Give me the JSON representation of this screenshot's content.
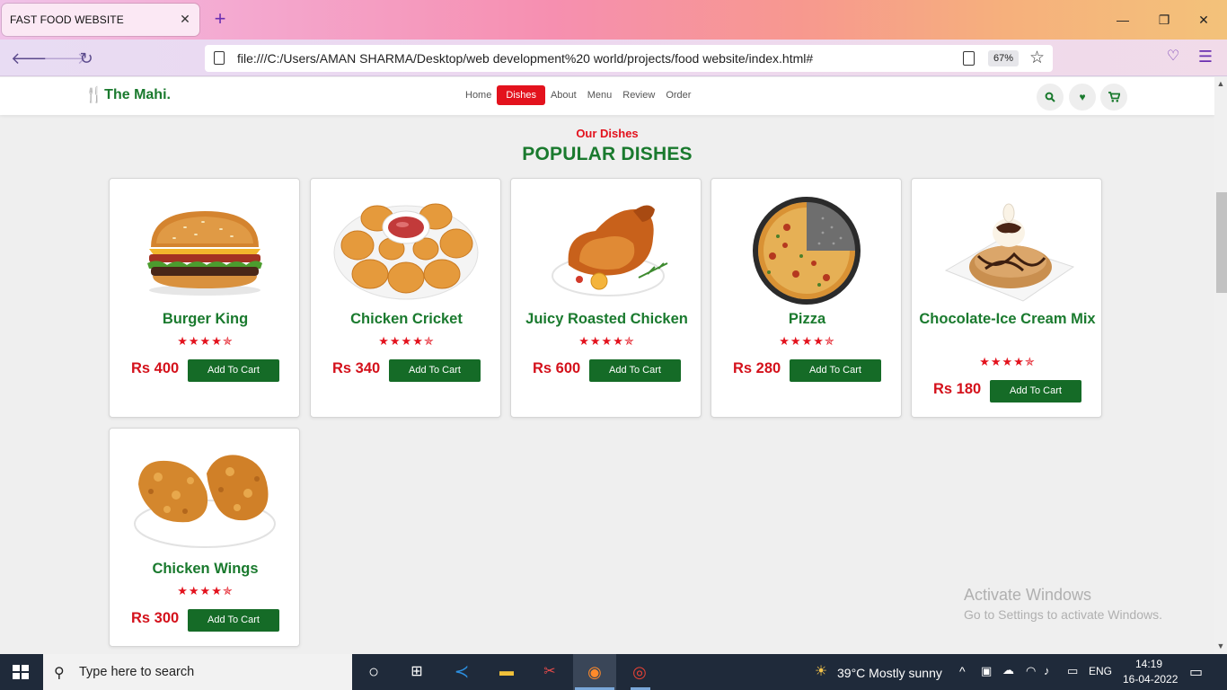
{
  "browser": {
    "tab_title": "FAST FOOD WEBSITE",
    "tab_close": "✕",
    "new_tab": "+",
    "url": "file:///C:/Users/AMAN SHARMA/Desktop/web development%20 world/projects/food website/index.html#",
    "zoom": "67%",
    "window_controls": [
      "—",
      "❐",
      "✕"
    ]
  },
  "site": {
    "logo": "The Mahi.",
    "nav": [
      "Home",
      "Dishes",
      "About",
      "Menu",
      "Review",
      "Order"
    ],
    "active_nav": "Dishes",
    "section_subheading": "Our Dishes",
    "section_heading": "POPULAR DISHES",
    "cart_label": "Add To Cart",
    "rating_glyphs": "★★★★✯",
    "dishes": [
      {
        "name": "Burger King",
        "price": "Rs 400",
        "rating": 4.5
      },
      {
        "name": "Chicken Cricket",
        "price": "Rs 340",
        "rating": 4.5
      },
      {
        "name": "Juicy Roasted Chicken",
        "price": "Rs 600",
        "rating": 4.5
      },
      {
        "name": "Pizza",
        "price": "Rs 280",
        "rating": 4.5
      },
      {
        "name": "Chocolate-Ice Cream Mix",
        "price": "Rs 180",
        "rating": 4.5
      },
      {
        "name": "Chicken Wings",
        "price": "Rs 300",
        "rating": 4.5
      }
    ]
  },
  "watermark": {
    "title": "Activate Windows",
    "subtitle": "Go to Settings to activate Windows."
  },
  "taskbar": {
    "search_placeholder": "Type here to search",
    "weather": "39°C  Mostly sunny",
    "language": "ENG",
    "time": "14:19",
    "date": "16-04-2022"
  },
  "colors": {
    "brand_green": "#1a7a2e",
    "accent_red": "#e3121d",
    "button_green": "#156b27"
  }
}
